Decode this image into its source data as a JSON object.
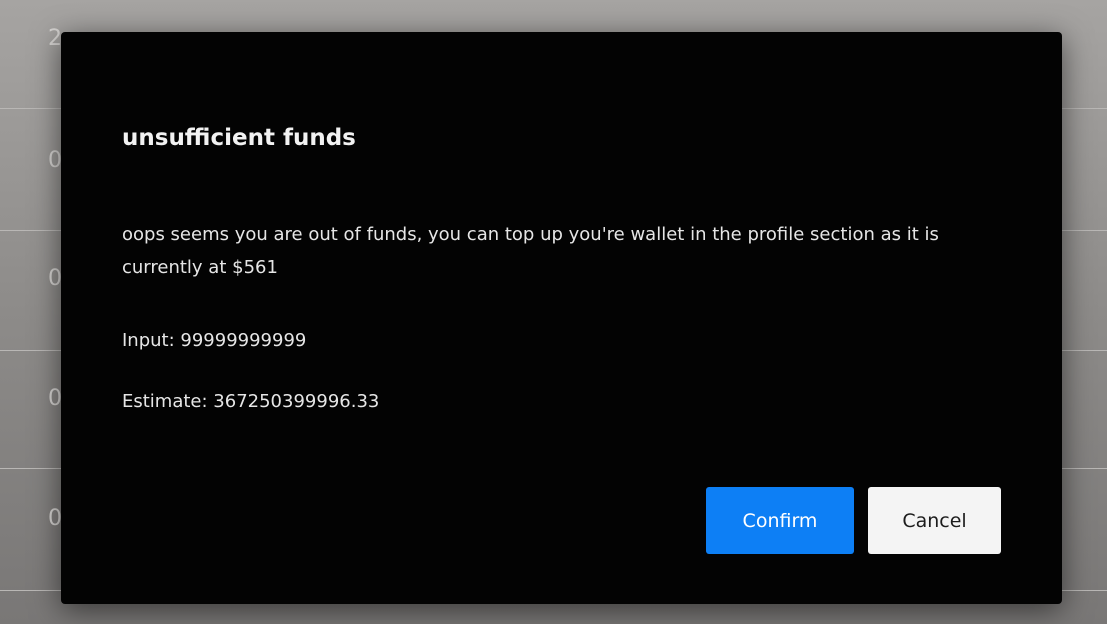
{
  "background": {
    "row_digits": [
      "2",
      "0",
      "0",
      "0",
      "0"
    ]
  },
  "dialog": {
    "title": "unsufficient funds",
    "message": "oops seems you are out of funds, you can top up you're wallet in the profile section as it is currently at $561",
    "input_line": "Input: 99999999999",
    "estimate_line": "Estimate: 367250399996.33",
    "confirm_label": "Confirm",
    "cancel_label": "Cancel"
  },
  "colors": {
    "dialog_background": "#030303",
    "primary_button": "#0d7ff5",
    "secondary_button": "#f4f4f4",
    "backdrop": "#8d8b89"
  }
}
